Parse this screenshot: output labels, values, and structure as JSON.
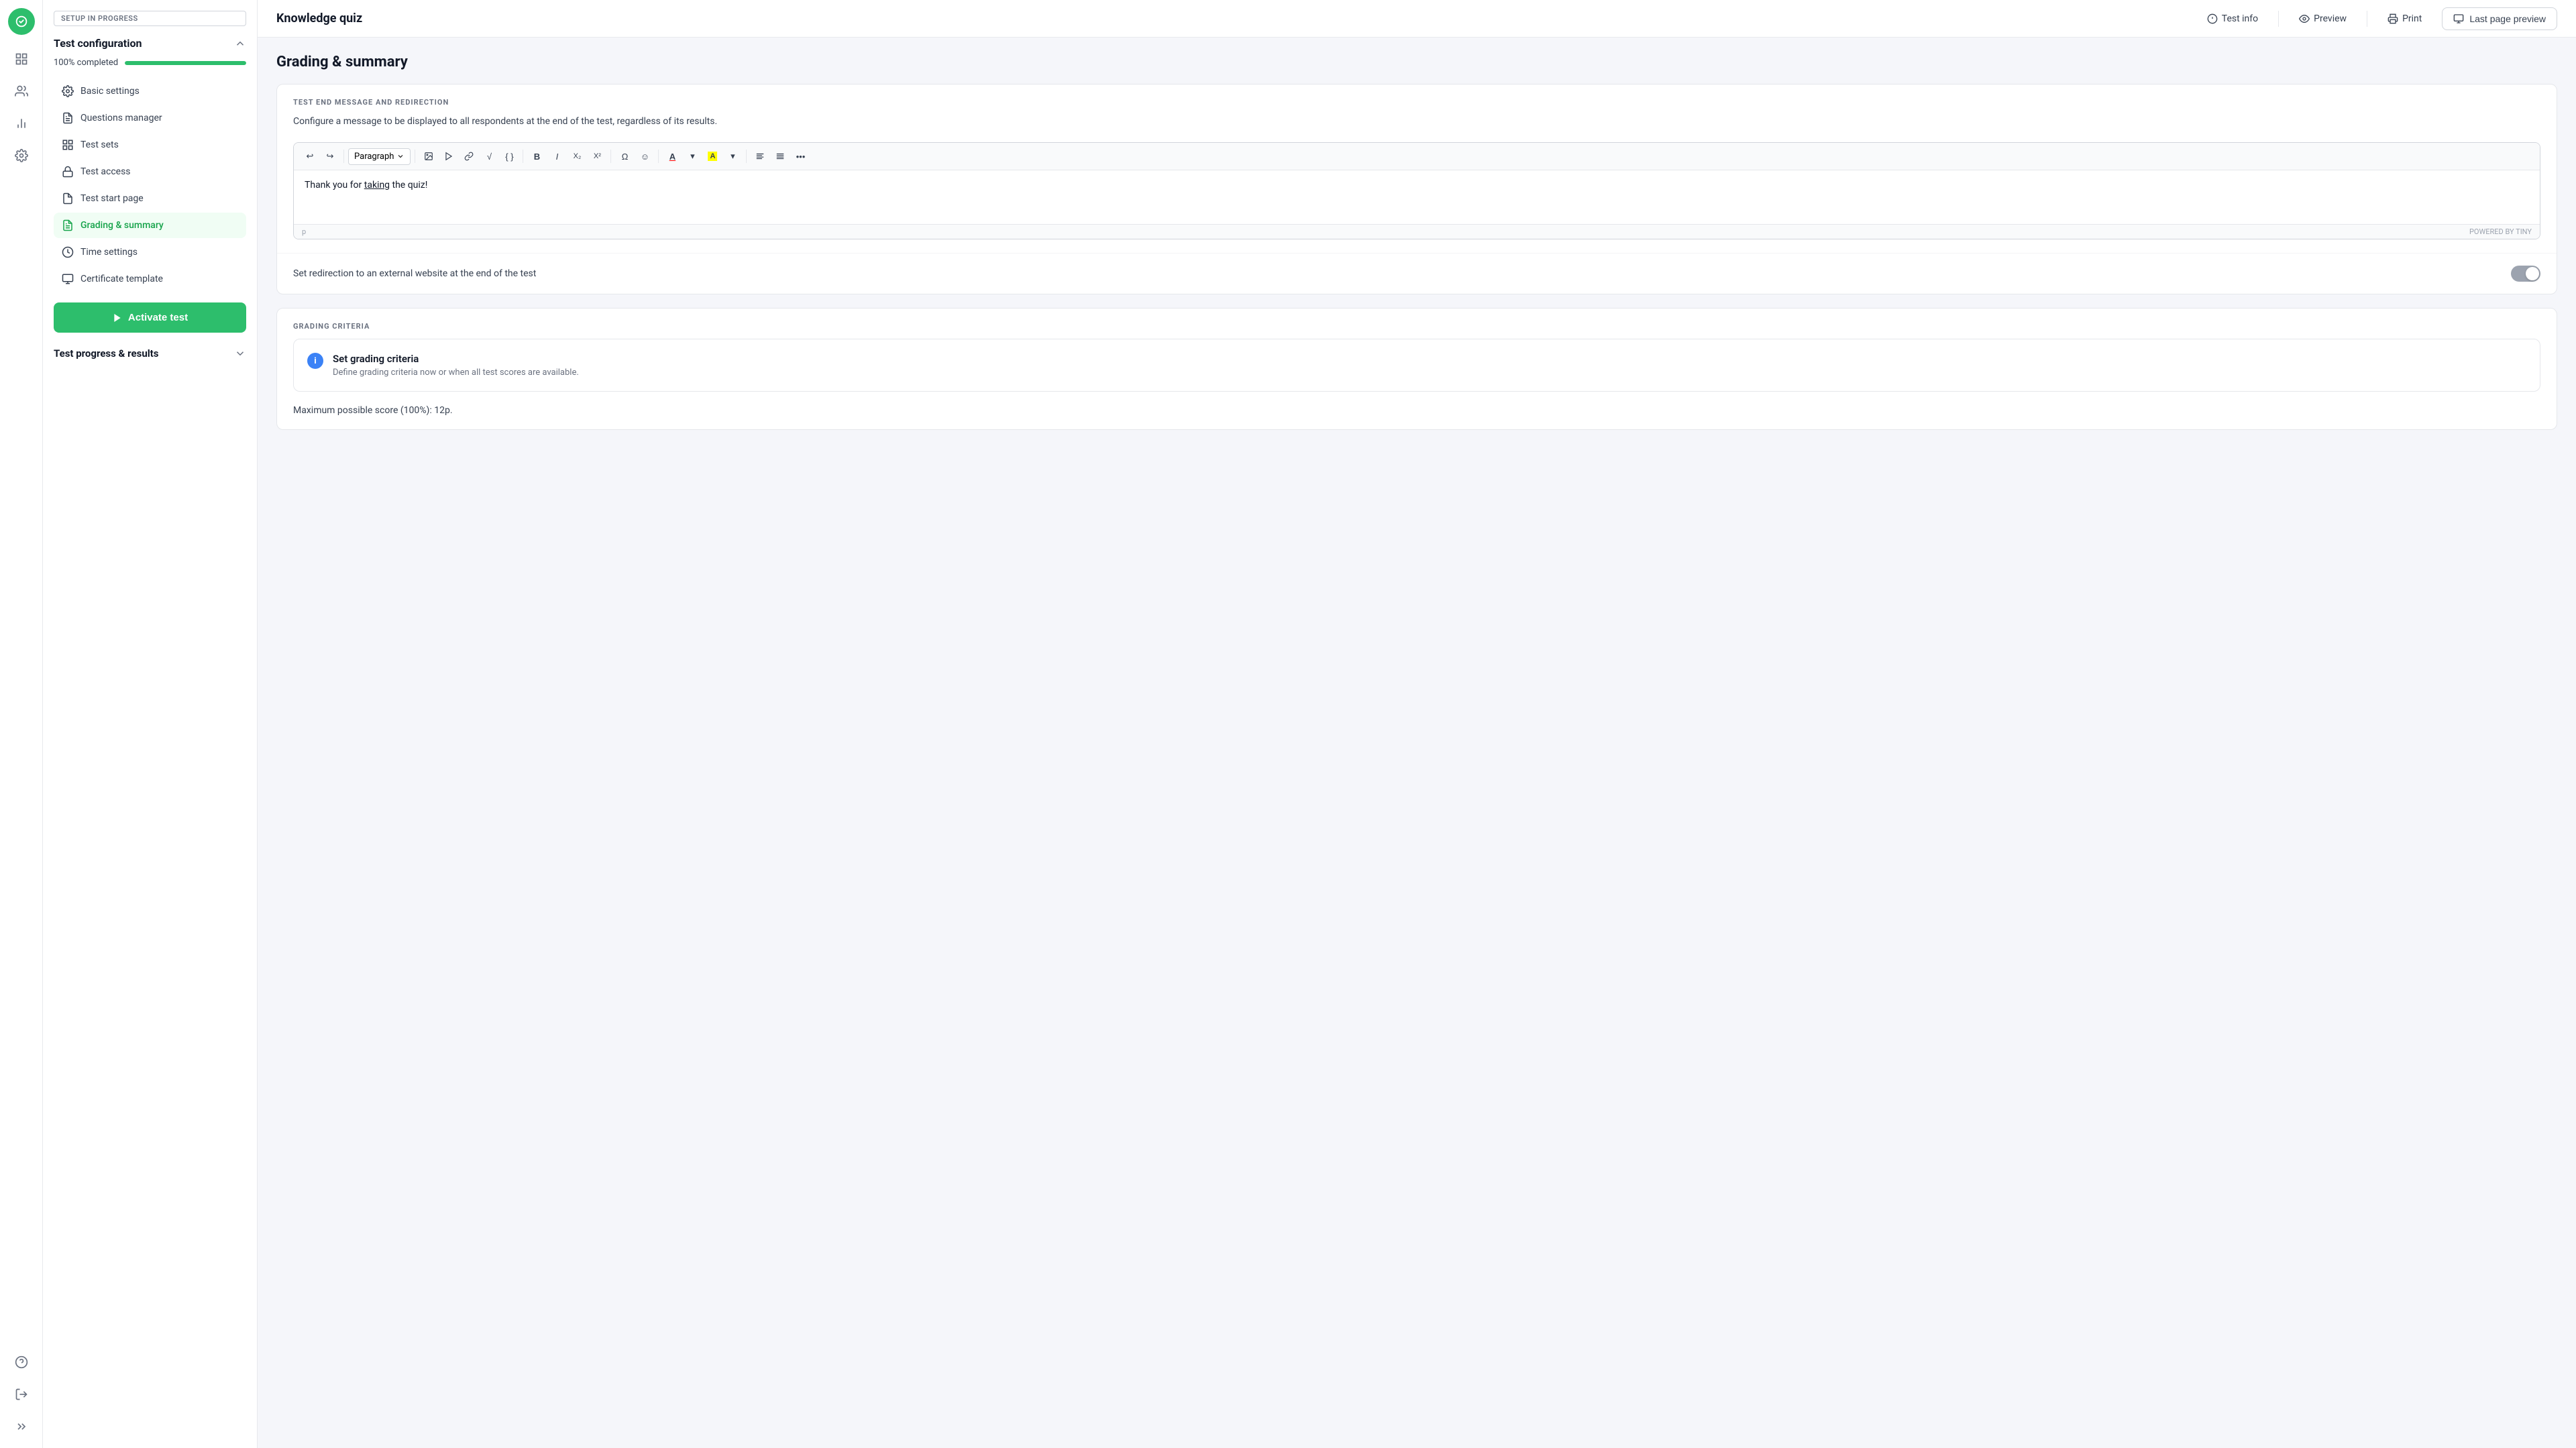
{
  "app": {
    "title": "Knowledge quiz"
  },
  "topbar": {
    "test_info_label": "Test info",
    "preview_label": "Preview",
    "print_label": "Print",
    "last_page_preview_label": "Last page preview"
  },
  "sidebar": {
    "setup_badge": "SETUP IN PROGRESS",
    "configuration_title": "Test configuration",
    "progress_label": "100% completed",
    "progress_value": 100,
    "nav_items": [
      {
        "id": "basic-settings",
        "label": "Basic settings",
        "icon": "settings"
      },
      {
        "id": "questions-manager",
        "label": "Questions manager",
        "icon": "questions"
      },
      {
        "id": "test-sets",
        "label": "Test sets",
        "icon": "sets"
      },
      {
        "id": "test-access",
        "label": "Test access",
        "icon": "lock"
      },
      {
        "id": "test-start-page",
        "label": "Test start page",
        "icon": "page"
      },
      {
        "id": "grading-summary",
        "label": "Grading & summary",
        "icon": "grading",
        "active": true
      },
      {
        "id": "time-settings",
        "label": "Time settings",
        "icon": "clock"
      },
      {
        "id": "certificate-template",
        "label": "Certificate template",
        "icon": "certificate"
      }
    ],
    "activate_btn_label": "Activate test",
    "section2_title": "Test progress & results"
  },
  "page": {
    "title": "Grading & summary",
    "section1": {
      "label": "TEST END MESSAGE AND REDIRECTION",
      "description": "Configure a message to be displayed to all respondents at the end of the test, regardless of its results.",
      "editor": {
        "paragraph_label": "Paragraph",
        "content": "Thank you for taking the quiz!",
        "content_underlined_word": "taking",
        "powered_by": "POWERED BY TINY",
        "path_label": "p"
      },
      "toggle_label": "Set redirection to an external website at the end of the test"
    },
    "section2": {
      "label": "GRADING CRITERIA",
      "criteria_title": "Set grading criteria",
      "criteria_description": "Define grading criteria now or when all test scores are available.",
      "max_score_label": "Maximum possible score (100%): 12p."
    }
  }
}
